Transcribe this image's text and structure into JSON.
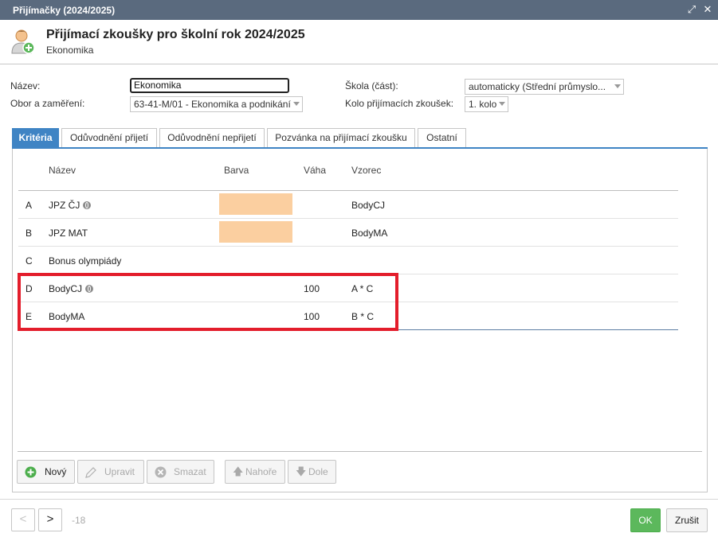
{
  "window": {
    "title": "Přijímačky (2024/2025)"
  },
  "header": {
    "title": "Přijímací zkoušky pro školní rok 2024/2025",
    "subtitle": "Ekonomika"
  },
  "form": {
    "nazev_label": "Název:",
    "nazev_value": "Ekonomika",
    "obor_label": "Obor a zaměření:",
    "obor_value": "63-41-M/01 - Ekonomika a podnikání",
    "skola_label": "Škola (část):",
    "skola_value": "automaticky (Střední průmyslo...",
    "kolo_label": "Kolo přijímacích zkoušek:",
    "kolo_value": "1. kolo"
  },
  "tabs": [
    {
      "label": "Kritéria",
      "active": true
    },
    {
      "label": "Odůvodnění přijetí"
    },
    {
      "label": "Odůvodnění nepřijetí"
    },
    {
      "label": "Pozvánka na přijímací zkoušku"
    },
    {
      "label": "Ostatní"
    }
  ],
  "table": {
    "columns": [
      "Název",
      "Barva",
      "Váha",
      "Vzorec"
    ],
    "rows": [
      {
        "letter": "A",
        "name": "JPZ ČJ",
        "globe": true,
        "color": "#fbcfa0",
        "weight": "",
        "formula": "BodyCJ"
      },
      {
        "letter": "B",
        "name": "JPZ MAT",
        "globe": false,
        "color": "#fbcfa0",
        "weight": "",
        "formula": "BodyMA"
      },
      {
        "letter": "C",
        "name": "Bonus olympiády",
        "globe": false,
        "color": "",
        "weight": "",
        "formula": ""
      },
      {
        "letter": "D",
        "name": "BodyCJ",
        "globe": true,
        "color": "",
        "weight": "100",
        "formula": "A * C"
      },
      {
        "letter": "E",
        "name": "BodyMA",
        "globe": false,
        "color": "",
        "weight": "100",
        "formula": "B * C"
      }
    ]
  },
  "toolbar": {
    "new_label": "Nový",
    "edit_label": "Upravit",
    "delete_label": "Smazat",
    "up_label": "Nahoře",
    "down_label": "Dole"
  },
  "footer": {
    "prev_icon": "chevron-left",
    "next_icon": "chevron-right",
    "page_info": "-18",
    "ok_label": "OK",
    "cancel_label": "Zrušit"
  },
  "colors": {
    "accent": "#3f84c4",
    "highlight": "#e31d2b",
    "ok": "#5cb85c",
    "titlebar": "#5a6a7e"
  }
}
